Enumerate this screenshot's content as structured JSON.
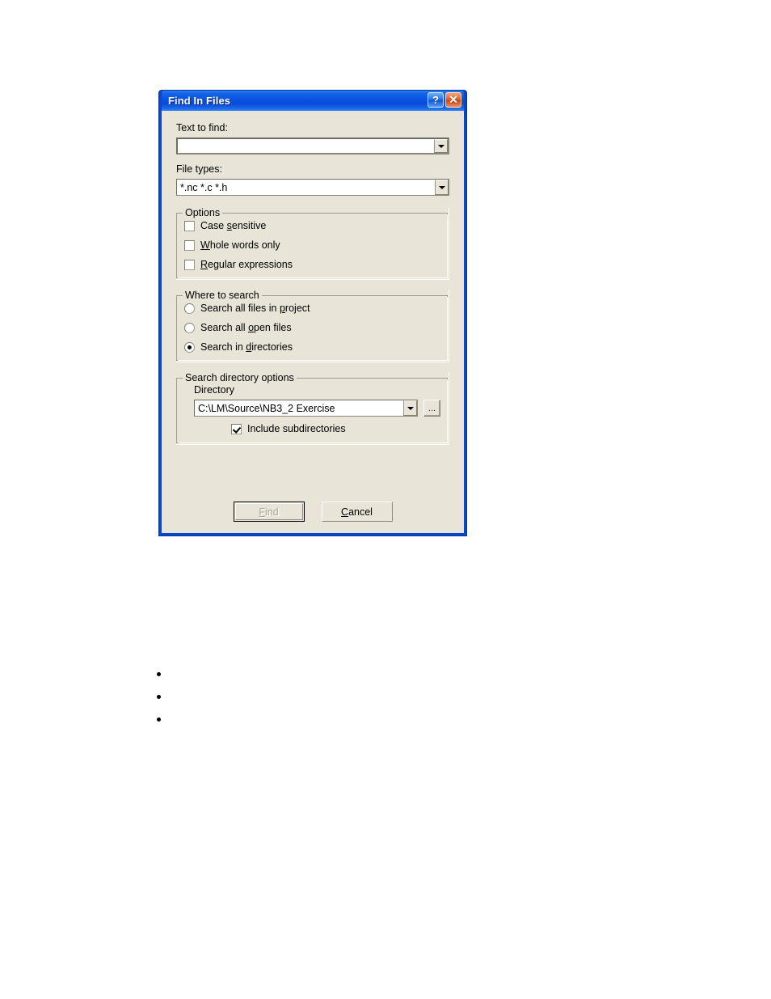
{
  "dialog": {
    "title": "Find In Files",
    "caption_buttons": [
      {
        "name": "help-button",
        "glyph": "?"
      },
      {
        "name": "close-button",
        "glyph": "✕"
      }
    ],
    "text_to_find": {
      "label": "Text to find:",
      "value": "",
      "placeholder": ""
    },
    "file_types": {
      "label": "File types:",
      "value": "*.nc *.c *.h"
    },
    "options_group": {
      "title": "Options",
      "items": [
        {
          "label_before": "Case ",
          "accel": "s",
          "label_after": "ensitive",
          "checked": false
        },
        {
          "label_before": "",
          "accel": "W",
          "label_after": "hole words only",
          "checked": false
        },
        {
          "label_before": "",
          "accel": "R",
          "label_after": "egular expressions",
          "checked": false
        }
      ]
    },
    "where_group": {
      "title": "Where to search",
      "items": [
        {
          "label_before": "Search all files in ",
          "accel": "p",
          "label_after": "roject",
          "selected": false
        },
        {
          "label_before": "Search all ",
          "accel": "o",
          "label_after": "pen files",
          "selected": false
        },
        {
          "label_before": "Search in ",
          "accel": "d",
          "label_after": "irectories",
          "selected": true
        }
      ]
    },
    "directory_group": {
      "title": "Search directory options",
      "directory_label": "Directory",
      "directory_value": "C:\\LM\\Source\\NB3_2 Exercise",
      "browse_label": "...",
      "include_subdirectories": {
        "label": "Include subdirectories",
        "checked": true
      }
    },
    "buttons": [
      {
        "label_before": "",
        "accel": "F",
        "label_after": "ind",
        "disabled": true,
        "is_default": true
      },
      {
        "label_before": "",
        "accel": "C",
        "label_after": "ancel",
        "disabled": false,
        "is_default": false
      }
    ],
    "colors": {
      "titlebar_blue": "#0a4ad8",
      "frame_blue": "#0a46c8",
      "client_background": "#e8e4d8",
      "close_button_orange": "#d4430f",
      "text": "#000000",
      "disabled_text": "#a8a598"
    }
  },
  "bullets": [
    {
      "text": ""
    },
    {
      "text": ""
    },
    {
      "text": ""
    }
  ]
}
